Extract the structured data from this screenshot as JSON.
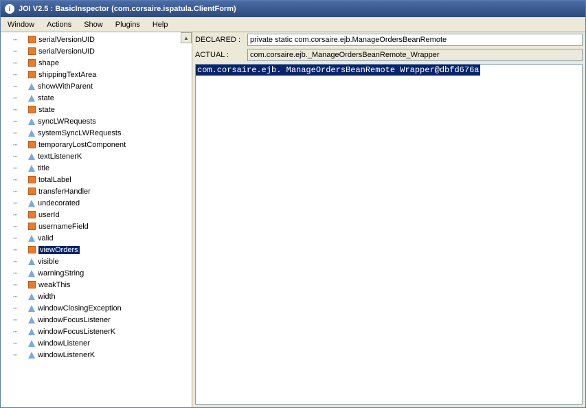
{
  "titlebar": {
    "icon_glyph": "i",
    "title": "JOI V2.5 : BasicInspector (com.corsaire.ispatula.ClientForm)"
  },
  "menubar": {
    "items": [
      "Window",
      "Actions",
      "Show",
      "Plugins",
      "Help"
    ]
  },
  "tree": {
    "selected_index": 24,
    "items": [
      {
        "label": "serialVersionUID",
        "kind": "field"
      },
      {
        "label": "serialVersionUID",
        "kind": "field"
      },
      {
        "label": "shape",
        "kind": "field"
      },
      {
        "label": "shippingTextArea",
        "kind": "field"
      },
      {
        "label": "showWithParent",
        "kind": "method"
      },
      {
        "label": "state",
        "kind": "method"
      },
      {
        "label": "state",
        "kind": "field"
      },
      {
        "label": "syncLWRequests",
        "kind": "method"
      },
      {
        "label": "systemSyncLWRequests",
        "kind": "method"
      },
      {
        "label": "temporaryLostComponent",
        "kind": "field"
      },
      {
        "label": "textListenerK",
        "kind": "method"
      },
      {
        "label": "title",
        "kind": "method"
      },
      {
        "label": "totalLabel",
        "kind": "field"
      },
      {
        "label": "transferHandler",
        "kind": "field"
      },
      {
        "label": "undecorated",
        "kind": "method"
      },
      {
        "label": "userId",
        "kind": "field"
      },
      {
        "label": "usernameField",
        "kind": "field"
      },
      {
        "label": "valid",
        "kind": "method"
      },
      {
        "label": "viewOrders",
        "kind": "field"
      },
      {
        "label": "visible",
        "kind": "method"
      },
      {
        "label": "warningString",
        "kind": "method"
      },
      {
        "label": "weakThis",
        "kind": "field"
      },
      {
        "label": "width",
        "kind": "method"
      },
      {
        "label": "windowClosingException",
        "kind": "method"
      },
      {
        "label": "windowFocusListener",
        "kind": "method"
      },
      {
        "label": "windowFocusListenerK",
        "kind": "method"
      },
      {
        "label": "windowListener",
        "kind": "method"
      },
      {
        "label": "windowListenerK",
        "kind": "method"
      }
    ]
  },
  "details": {
    "declared_label": "DECLARED :",
    "declared_value": "private static com.corsaire.ejb.ManageOrdersBeanRemote",
    "actual_label": "ACTUAL :",
    "actual_value": "com.corsaire.ejb._ManageOrdersBeanRemote_Wrapper",
    "body": "com.corsaire.ejb. ManageOrdersBeanRemote Wrapper@dbfd676a"
  }
}
